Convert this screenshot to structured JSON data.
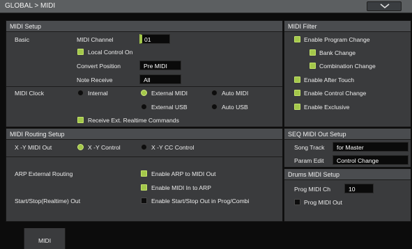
{
  "title": "GLOBAL > MIDI",
  "midi_setup": {
    "heading": "MIDI Setup",
    "basic": {
      "label": "Basic",
      "midi_channel_label": "MIDI Channel",
      "midi_channel_value": "01",
      "local_control_label": "Local Control On",
      "local_control_on": true,
      "convert_position_label": "Convert Position",
      "convert_position_value": "Pre MIDI",
      "note_receive_label": "Note Receive",
      "note_receive_value": "All"
    },
    "clock": {
      "label": "MIDI Clock",
      "options": [
        "Internal",
        "External MIDI",
        "Auto MIDI",
        "External USB",
        "Auto USB"
      ],
      "selected": "External MIDI",
      "receive_ext_label": "Receive Ext. Realtime Commands",
      "receive_ext_on": true
    }
  },
  "routing": {
    "heading": "MIDI Routing Setup",
    "xy_label": "X -Y MIDI Out",
    "xy_options": [
      "X -Y Control",
      "X -Y CC Control"
    ],
    "xy_selected": "X -Y Control",
    "arp_label": "ARP External Routing",
    "enable_arp_to_midi_label": "Enable ARP to MIDI Out",
    "enable_arp_to_midi_on": true,
    "enable_midi_to_arp_label": "Enable MIDI In to ARP",
    "enable_midi_to_arp_on": true,
    "startstop_label": "Start/Stop(Realtime) Out",
    "enable_startstop_label": "Enable Start/Stop Out in Prog/Combi",
    "enable_startstop_on": false
  },
  "filter": {
    "heading": "MIDI Filter",
    "items": [
      {
        "label": "Enable Program Change",
        "on": true
      },
      {
        "label": "Bank Change",
        "on": true
      },
      {
        "label": "Combination Change",
        "on": true
      },
      {
        "label": "Enable After Touch",
        "on": true
      },
      {
        "label": "Enable Control Change",
        "on": true
      },
      {
        "label": "Enable Exclusive",
        "on": true
      }
    ]
  },
  "seq_out": {
    "heading": "SEQ MIDI Out Setup",
    "song_track_label": "Song Track",
    "song_track_value": "for Master",
    "param_edit_label": "Param Edit",
    "param_edit_value": "Control Change"
  },
  "drums": {
    "heading": "Drums MIDI Setup",
    "prog_ch_label": "Prog MIDI Ch",
    "prog_ch_value": "10",
    "prog_out_label": "Prog MIDI Out",
    "prog_out_on": false
  },
  "tabs": [
    "MIDI"
  ],
  "colors": {
    "accent": "#a3c74a",
    "panel": "#3a3b3d",
    "header": "#4a4c4f"
  }
}
